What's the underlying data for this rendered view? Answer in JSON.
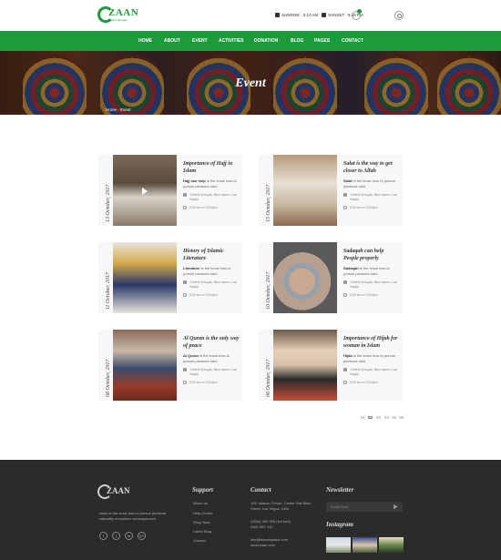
{
  "brand": {
    "name": "ZAAN",
    "tagline": "Islamic Mosque"
  },
  "header": {
    "sunrise": "SUNRISE : 5:10 AM",
    "sunset": "SUNSET : 5:49 PM",
    "cart_count": "0"
  },
  "nav": [
    "HOME",
    "ABOUT",
    "EVENT",
    "ACTIVITIES",
    "DONATION",
    "BLOG",
    "PAGES",
    "CONTACT"
  ],
  "hero": {
    "title": "Event",
    "breadcrumb": "Home - Event"
  },
  "events": [
    {
      "date": "13 October, 2017",
      "title": "Importance of Hajj in Islam",
      "lead": "Hajj can help",
      "excerpt": " is the know how to pursue pleasure ratio",
      "venue": "Central Mosque, New haven, Las Vegas",
      "time": "8:00 am to 12:00pm"
    },
    {
      "date": "15 October, 2017",
      "title": "Salat is the way to get closer to Allah",
      "lead": "Salat",
      "excerpt": " is the know how to pursue pleasure ratio",
      "venue": "Central Mosque, New haven, Las Vegas",
      "time": "8:00 am to 12:00pm"
    },
    {
      "date": "11 October, 2017",
      "title": "History of Islamic Literature",
      "lead": "Literature",
      "excerpt": " is the know how to pursue pleasure ratio",
      "venue": "Central Mosque, New haven, Las Vegas",
      "time": "8:00 am to 12:00pm"
    },
    {
      "date": "10 October, 2017",
      "title": "Sadaqah can help People properly",
      "lead": "Sadaqah",
      "excerpt": " is the know how to pursue pleasure ratio",
      "venue": "Central Mosque, New haven, Las Vegas",
      "time": "8:00 am to 12:00pm"
    },
    {
      "date": "08 October, 2017",
      "title": "Al Quran is the only way of peace",
      "lead": "Al Quran",
      "excerpt": " is the know how to pursue pleasure ratio",
      "venue": "Central Mosque, New haven, Las Vegas",
      "time": "8:00 am to 12:00pm"
    },
    {
      "date": "06 October, 2017",
      "title": "Importance of Hijab for woman in Islam",
      "lead": "Hijab",
      "excerpt": " is the know how to pursue pleasure ratio",
      "venue": "Central Mosque, New haven, Las Vegas",
      "time": "8:00 am to 12:00pm"
    }
  ],
  "pagination": [
    "01",
    "02",
    "03",
    "04",
    "05",
    "06"
  ],
  "footer": {
    "about": "Islam is the know how to pursue pleasure rationally encounter consequences",
    "social": [
      "f",
      "t",
      "in",
      "G+"
    ],
    "support_title": "Support",
    "support_links": [
      "About us",
      "Help Centre",
      "Shop Now",
      "Latest Blog",
      "Contact"
    ],
    "contact_title": "Contact",
    "address": "159, Islamic Centre, Center Hall Main Street, Las Vegas, USA",
    "phone1": "(0554) 300 900 (toll free)",
    "phone2": "0302 587 412",
    "email": "info@islamicplace.com",
    "web": "www.zaan.com",
    "newsletter_title": "Newsletter",
    "newsletter_placeholder": "Email here",
    "instagram_title": "Instagram"
  }
}
